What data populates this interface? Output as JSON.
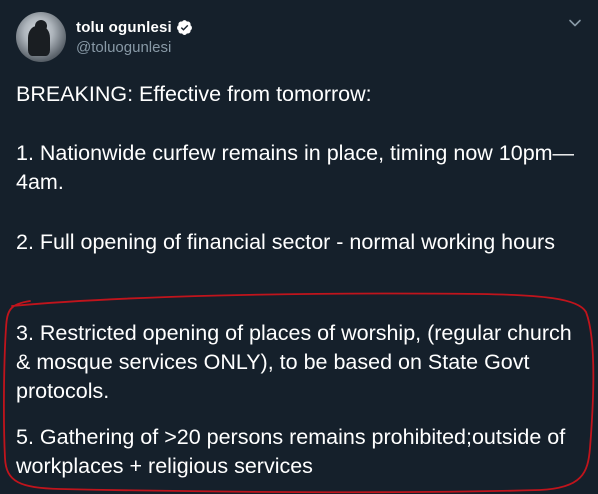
{
  "author": {
    "display_name": "tolu ogunlesi",
    "handle": "@toluogunlesi",
    "verified": true
  },
  "tweet": {
    "paragraphs": {
      "breaking": "BREAKING: Effective from tomorrow:",
      "item1": "1. Nationwide curfew remains in place, timing now 10pm—4am.",
      "item2": "2. Full opening of financial sector - normal working hours",
      "item3": "3. Restricted opening of places of worship, (regular church & mosque services ONLY), to be based on State Govt protocols.",
      "item5": "5. Gathering of >20 persons remains prohibited;outside of workplaces + religious services"
    }
  },
  "icons": {
    "verified": "verified-badge-icon",
    "caret": "chevron-down-icon"
  },
  "colors": {
    "background": "#15202b",
    "text": "#ffffff",
    "handle": "#8899a6",
    "highlight_ring": "#c0141c"
  }
}
